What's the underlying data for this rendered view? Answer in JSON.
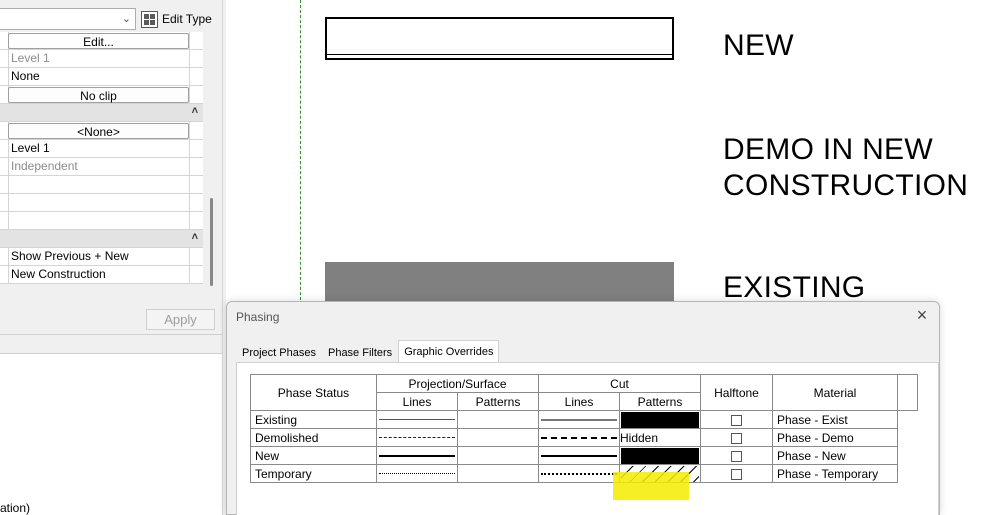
{
  "properties": {
    "type_selector_value": "",
    "edit_type_label": "Edit Type",
    "rows": [
      {
        "kind": "button",
        "value": "Edit..."
      },
      {
        "kind": "grey",
        "value": "Level 1"
      },
      {
        "kind": "text",
        "value": "None"
      },
      {
        "kind": "button",
        "value": "No clip"
      },
      {
        "kind": "header",
        "value": ""
      },
      {
        "kind": "button",
        "value": "<None>"
      },
      {
        "kind": "text",
        "value": "Level 1"
      },
      {
        "kind": "grey",
        "value": "Independent"
      },
      {
        "kind": "text",
        "value": ""
      },
      {
        "kind": "text",
        "value": ""
      },
      {
        "kind": "text",
        "value": ""
      },
      {
        "kind": "header",
        "value": ""
      },
      {
        "kind": "text",
        "value": "Show Previous + New"
      },
      {
        "kind": "text",
        "value": "New Construction"
      }
    ],
    "apply_label": "Apply",
    "browser_fragment": "ation)"
  },
  "canvas": {
    "labels": {
      "new": "NEW",
      "demo_line1": "DEMO IN NEW",
      "demo_line2": "CONSTRUCTION",
      "existing": "EXISTING"
    }
  },
  "dialog": {
    "title": "Phasing",
    "tabs": [
      "Project Phases",
      "Phase Filters",
      "Graphic Overrides"
    ],
    "active_tab": "Graphic Overrides",
    "table": {
      "headers": {
        "phase_status": "Phase Status",
        "projection_surface": "Projection/Surface",
        "cut": "Cut",
        "halftone": "Halftone",
        "material": "Material",
        "lines": "Lines",
        "patterns": "Patterns"
      },
      "rows": [
        {
          "status": "Existing",
          "proj_line": "thin",
          "cut_line": "boldgrey",
          "cut_pattern": "solid",
          "cut_pattern_text": "",
          "halftone": false,
          "material": "Phase - Exist"
        },
        {
          "status": "Demolished",
          "proj_line": "dash",
          "cut_line": "bolddash",
          "cut_pattern": "text",
          "cut_pattern_text": "Hidden",
          "halftone": false,
          "material": "Phase - Demo"
        },
        {
          "status": "New",
          "proj_line": "bold",
          "cut_line": "bold",
          "cut_pattern": "solid",
          "cut_pattern_text": "",
          "halftone": false,
          "material": "Phase - New"
        },
        {
          "status": "Temporary",
          "proj_line": "dot",
          "cut_line": "bolddot",
          "cut_pattern": "hatch",
          "cut_pattern_text": "",
          "halftone": false,
          "material": "Phase - Temporary"
        }
      ]
    },
    "highlight_color": "#f5ec00"
  }
}
